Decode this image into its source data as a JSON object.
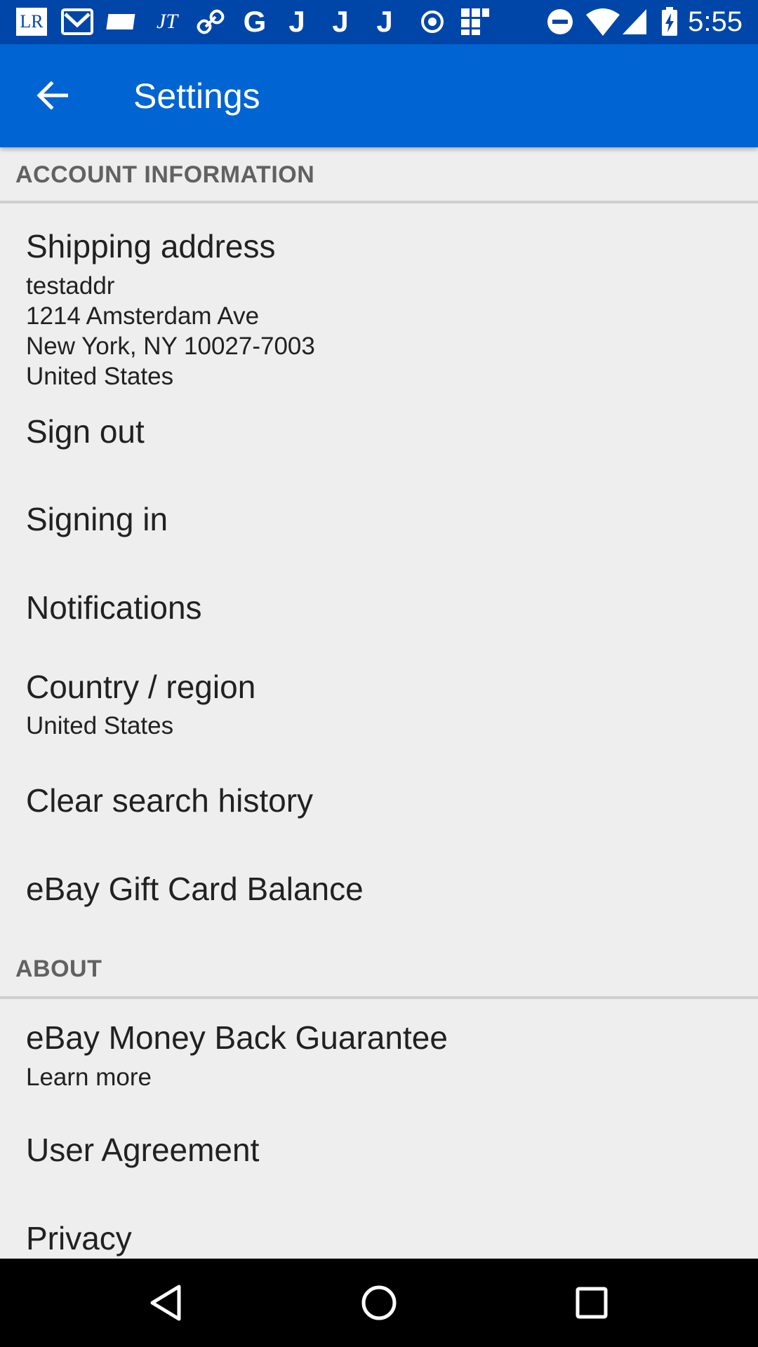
{
  "status_bar": {
    "time": "5:55",
    "notification_icons": [
      "lr-icon",
      "mail-icon",
      "ticket-icon",
      "jt-icon",
      "link-icon",
      "google-icon",
      "j-icon",
      "j-icon",
      "j-icon",
      "record-icon",
      "grid-icon"
    ],
    "system_icons": [
      "do-not-disturb-icon",
      "wifi-icon",
      "signal-icon",
      "battery-charging-icon"
    ],
    "lr_text": "LR",
    "jt_text": "JT",
    "g_text": "G",
    "j_text": "J"
  },
  "app_bar": {
    "title": "Settings",
    "background_color": "#0064d2"
  },
  "sections": {
    "account": {
      "header": "ACCOUNT INFORMATION",
      "items": {
        "shipping": {
          "title": "Shipping address",
          "summary": "testaddr\n1214 Amsterdam Ave\nNew York, NY 10027-7003\nUnited States"
        },
        "sign_out": {
          "title": "Sign out"
        },
        "signing_in": {
          "title": "Signing in"
        },
        "notifications": {
          "title": "Notifications"
        },
        "country": {
          "title": "Country / region",
          "summary": "United States"
        },
        "clear_history": {
          "title": "Clear search history"
        },
        "gift_card": {
          "title": "eBay Gift Card Balance"
        }
      }
    },
    "about": {
      "header": "ABOUT",
      "items": {
        "money_back": {
          "title": "eBay Money Back Guarantee",
          "summary": "Learn more"
        },
        "user_agreement": {
          "title": "User Agreement"
        },
        "privacy": {
          "title": "Privacy"
        }
      }
    }
  },
  "nav_bar": {
    "buttons": [
      "back-triangle-icon",
      "home-circle-icon",
      "recents-square-icon"
    ]
  }
}
